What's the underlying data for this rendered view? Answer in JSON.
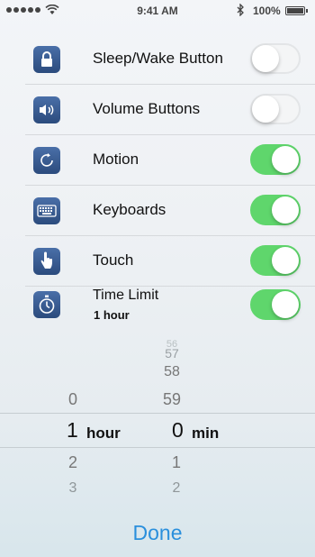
{
  "status_bar": {
    "time": "9:41 AM",
    "battery_text": "100%",
    "signal_dots": 5
  },
  "rows": [
    {
      "id": "sleep",
      "label": "Sleep/Wake Button",
      "icon": "lock-icon",
      "toggle": false
    },
    {
      "id": "volume",
      "label": "Volume Buttons",
      "icon": "speaker-icon",
      "toggle": false
    },
    {
      "id": "motion",
      "label": "Motion",
      "icon": "rotate-icon",
      "toggle": true
    },
    {
      "id": "keyboards",
      "label": "Keyboards",
      "icon": "keyboard-icon",
      "toggle": true
    },
    {
      "id": "touch",
      "label": "Touch",
      "icon": "hand-touch-icon",
      "toggle": true
    },
    {
      "id": "timelimit",
      "label": "Time Limit",
      "sublabel": "1 hour",
      "icon": "timer-icon",
      "toggle": true
    }
  ],
  "picker": {
    "hours_above": [
      "0"
    ],
    "hours_selected": "1",
    "hours_unit": "hour",
    "hours_below": [
      "2",
      "3"
    ],
    "minutes_above": [
      "56",
      "57",
      "58",
      "59"
    ],
    "minutes_selected": "0",
    "minutes_unit": "min",
    "minutes_below": [
      "1",
      "2"
    ]
  },
  "done_label": "Done",
  "colors": {
    "toggle_on": "#5fd66c",
    "accent": "#2a8fdc",
    "icon_bg": "#3b5c8f"
  }
}
